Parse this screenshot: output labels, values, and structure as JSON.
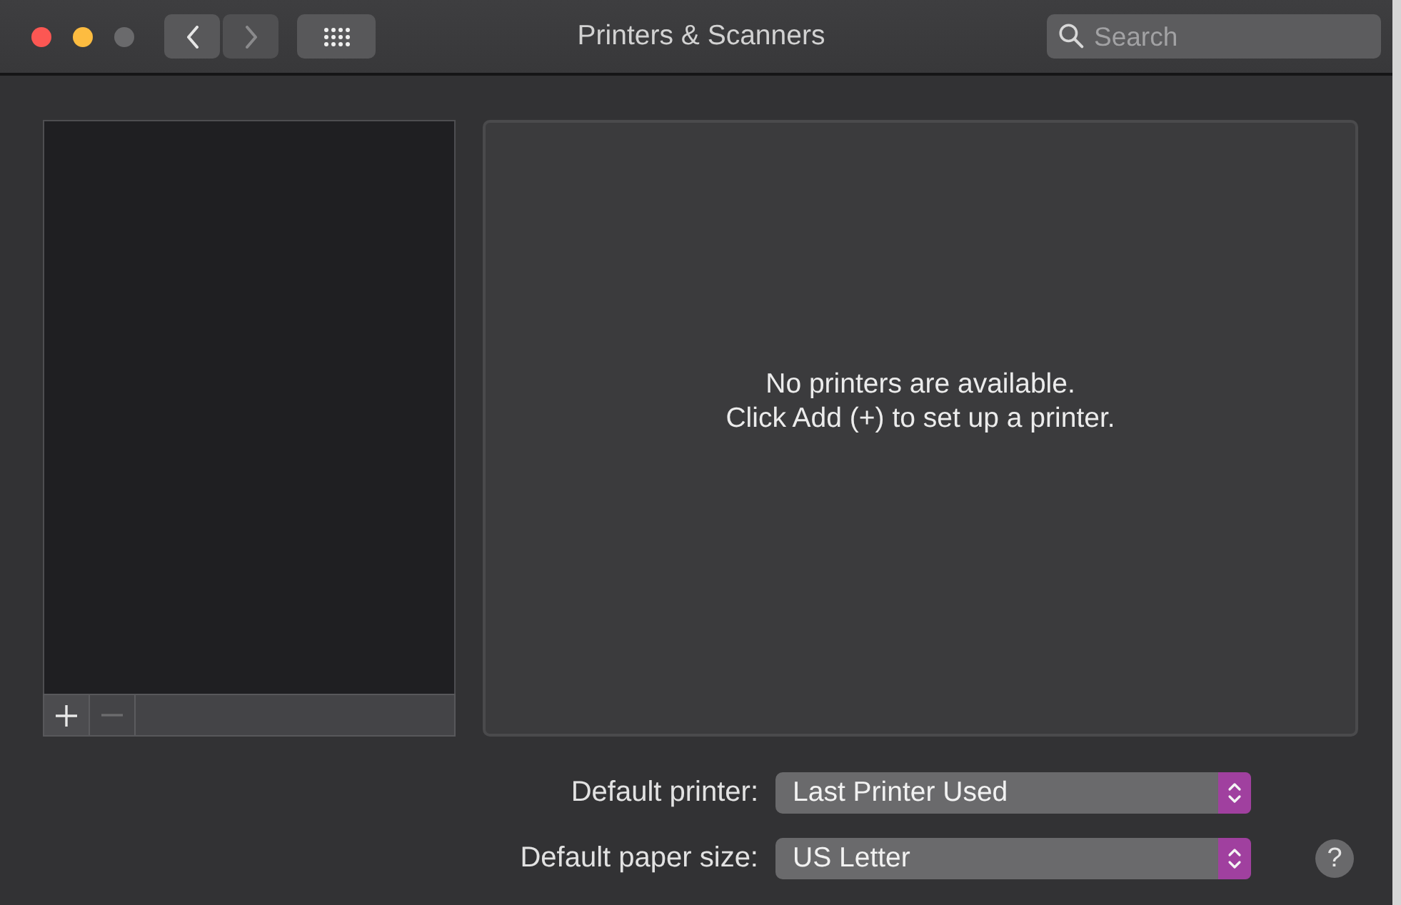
{
  "window": {
    "title": "Printers & Scanners"
  },
  "window_controls": [
    {
      "kind": "close",
      "disabled": false
    },
    {
      "kind": "minimize",
      "disabled": false
    },
    {
      "kind": "zoom",
      "disabled": true
    }
  ],
  "nav_buttons": [
    {
      "kind": "back",
      "disabled": false
    },
    {
      "kind": "forward",
      "disabled": true
    }
  ],
  "search": {
    "placeholder": "Search"
  },
  "printer_list": {
    "buttons": [
      {
        "kind": "add",
        "disabled": false
      },
      {
        "kind": "remove",
        "disabled": true
      }
    ]
  },
  "detail_panel": {
    "message": "No printers are available.",
    "hint": "Click Add (+) to set up a printer."
  },
  "settings": [
    {
      "label": "Default printer:",
      "value": "Last Printer Used"
    },
    {
      "label": "Default paper size:",
      "value": "US Letter"
    }
  ],
  "help_button": {
    "label": "?"
  }
}
